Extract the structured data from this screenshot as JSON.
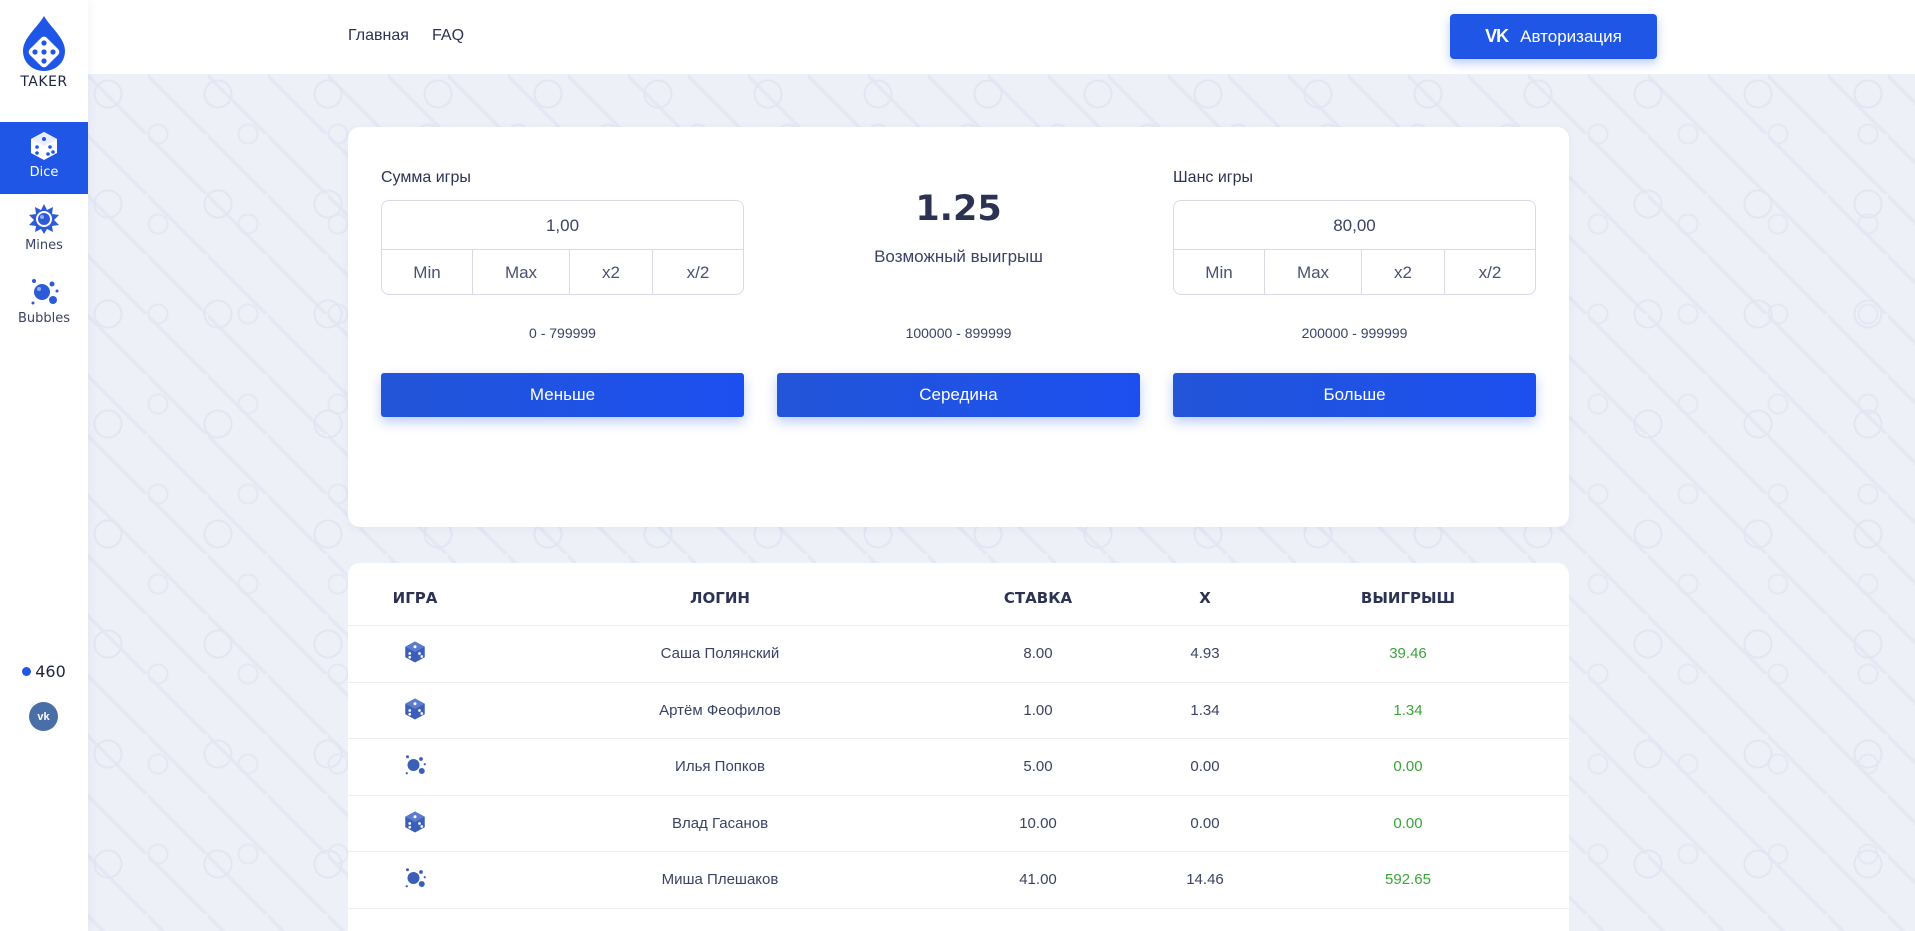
{
  "brand": {
    "name": "TAKER"
  },
  "sidebar": {
    "items": [
      {
        "label": "Dice",
        "icon": "dice-icon",
        "active": true
      },
      {
        "label": "Mines",
        "icon": "mine-icon",
        "active": false
      },
      {
        "label": "Bubbles",
        "icon": "bubbles-icon",
        "active": false
      }
    ],
    "online_count": "460",
    "vk_label": "vk"
  },
  "header": {
    "links": [
      {
        "label": "Главная"
      },
      {
        "label": "FAQ"
      }
    ],
    "auth_button": {
      "vk": "VK",
      "label": "Авторизация"
    }
  },
  "game": {
    "amount": {
      "label": "Сумма игры",
      "value": "1,00",
      "buttons": [
        "Min",
        "Max",
        "x2",
        "x/2"
      ]
    },
    "payout": {
      "value": "1.25",
      "label": "Возможный выигрыш"
    },
    "chance": {
      "label": "Шанс игры",
      "value": "80,00",
      "buttons": [
        "Min",
        "Max",
        "x2",
        "x/2"
      ]
    },
    "ranges": [
      "0 - 799999",
      "100000 - 899999",
      "200000 - 999999"
    ],
    "actions": [
      "Меньше",
      "Середина",
      "Больше"
    ]
  },
  "history": {
    "columns": [
      "ИГРА",
      "ЛОГИН",
      "СТАВКА",
      "X",
      "ВЫИГРЫШ"
    ],
    "rows": [
      {
        "game_icon": "dice-icon",
        "login": "Саша Полянский",
        "bet": "8.00",
        "x": "4.93",
        "win": "39.46"
      },
      {
        "game_icon": "dice-icon",
        "login": "Артём Феофилов",
        "bet": "1.00",
        "x": "1.34",
        "win": "1.34"
      },
      {
        "game_icon": "bubbles-icon",
        "login": "Илья Попков",
        "bet": "5.00",
        "x": "0.00",
        "win": "0.00"
      },
      {
        "game_icon": "dice-icon",
        "login": "Влад Гасанов",
        "bet": "10.00",
        "x": "0.00",
        "win": "0.00"
      },
      {
        "game_icon": "bubbles-icon",
        "login": "Миша Плешаков",
        "bet": "41.00",
        "x": "14.46",
        "win": "592.65"
      }
    ]
  },
  "colors": {
    "accent": "#1f56e6",
    "win": "#3aa53a",
    "text": "#2b3252"
  }
}
